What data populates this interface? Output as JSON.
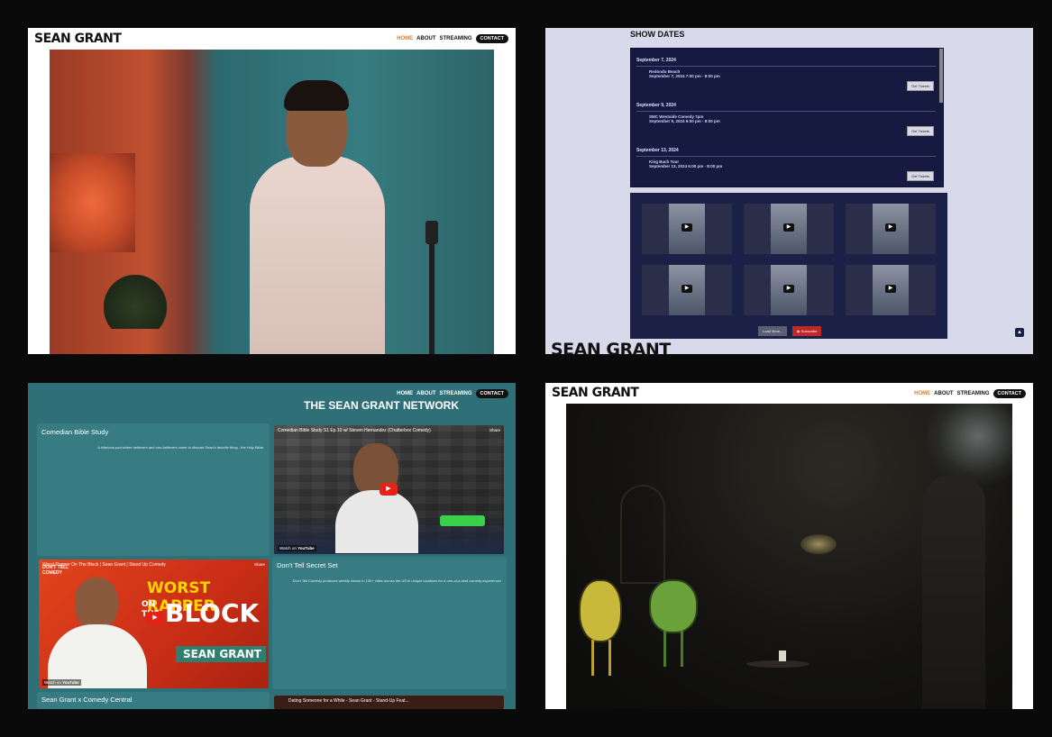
{
  "brand": {
    "name": "SEAN GRANT"
  },
  "nav": {
    "home": "HOME",
    "about": "ABOUT",
    "streaming": "STREAMING",
    "contact": "CONTACT"
  },
  "colors": {
    "accent": "#e67e22",
    "network_bg": "#2f7078",
    "showdates_bg": "#161a40",
    "youtube_red": "#e62117"
  },
  "show_dates": {
    "title": "SHOW DATES",
    "events": [
      {
        "date": "September 7, 2024",
        "name": "Redondo Beach",
        "time": "September 7, 2024  7:00 pm - 8:00 pm",
        "button": "Get Tickets"
      },
      {
        "date": "September 9, 2024",
        "name": "SMC Westside Comedy 7pm",
        "time": "September 9, 2024  6:00 pm - 8:00 pm",
        "button": "Get Tickets"
      },
      {
        "date": "September 13, 2024",
        "name": "King Bach Tour",
        "time": "September 13, 2024  6:00 pm - 8:00 pm",
        "button": "Get Tickets"
      }
    ],
    "load_more": "Load More...",
    "subscribe": "Subscribe"
  },
  "network": {
    "title": "THE SEAN GRANT NETWORK",
    "sections": [
      {
        "title": "Comedian Bible Study",
        "description": "A hilarious pod where believers and non-believers come to discuss Sean's favorite thing - the Holy Bible.",
        "video_title": "Comedian Bible Study S1 Ep 10 w/ Steven Hernandez (Chatterbox Comedy)",
        "watch_on": "Watch on",
        "yt_brand": "YouTube",
        "share": "Share"
      },
      {
        "title": "Don't Tell Secret Set",
        "description": "Don't Tell Comedy produces weekly shows in 100+ cities across the US in unique locations for a one-of-a-kind comedy experience!",
        "video_title": "Worst Rapper On The Block | Sean Grant | Stand Up Comedy",
        "thumb_line1": "WORST RAPPER",
        "thumb_on": "ON",
        "thumb_the": "THE",
        "thumb_block": "BLOCK",
        "thumb_name": "SEAN GRANT",
        "badge": "DON'T TELL COMEDY",
        "watch_on": "Watch on",
        "yt_brand": "YouTube",
        "share": "Share"
      },
      {
        "title": "Sean Grant x Comedy Central",
        "video_title": "Dating Someone for a While - Sean Grant - Stand-Up Feat..."
      }
    ]
  }
}
